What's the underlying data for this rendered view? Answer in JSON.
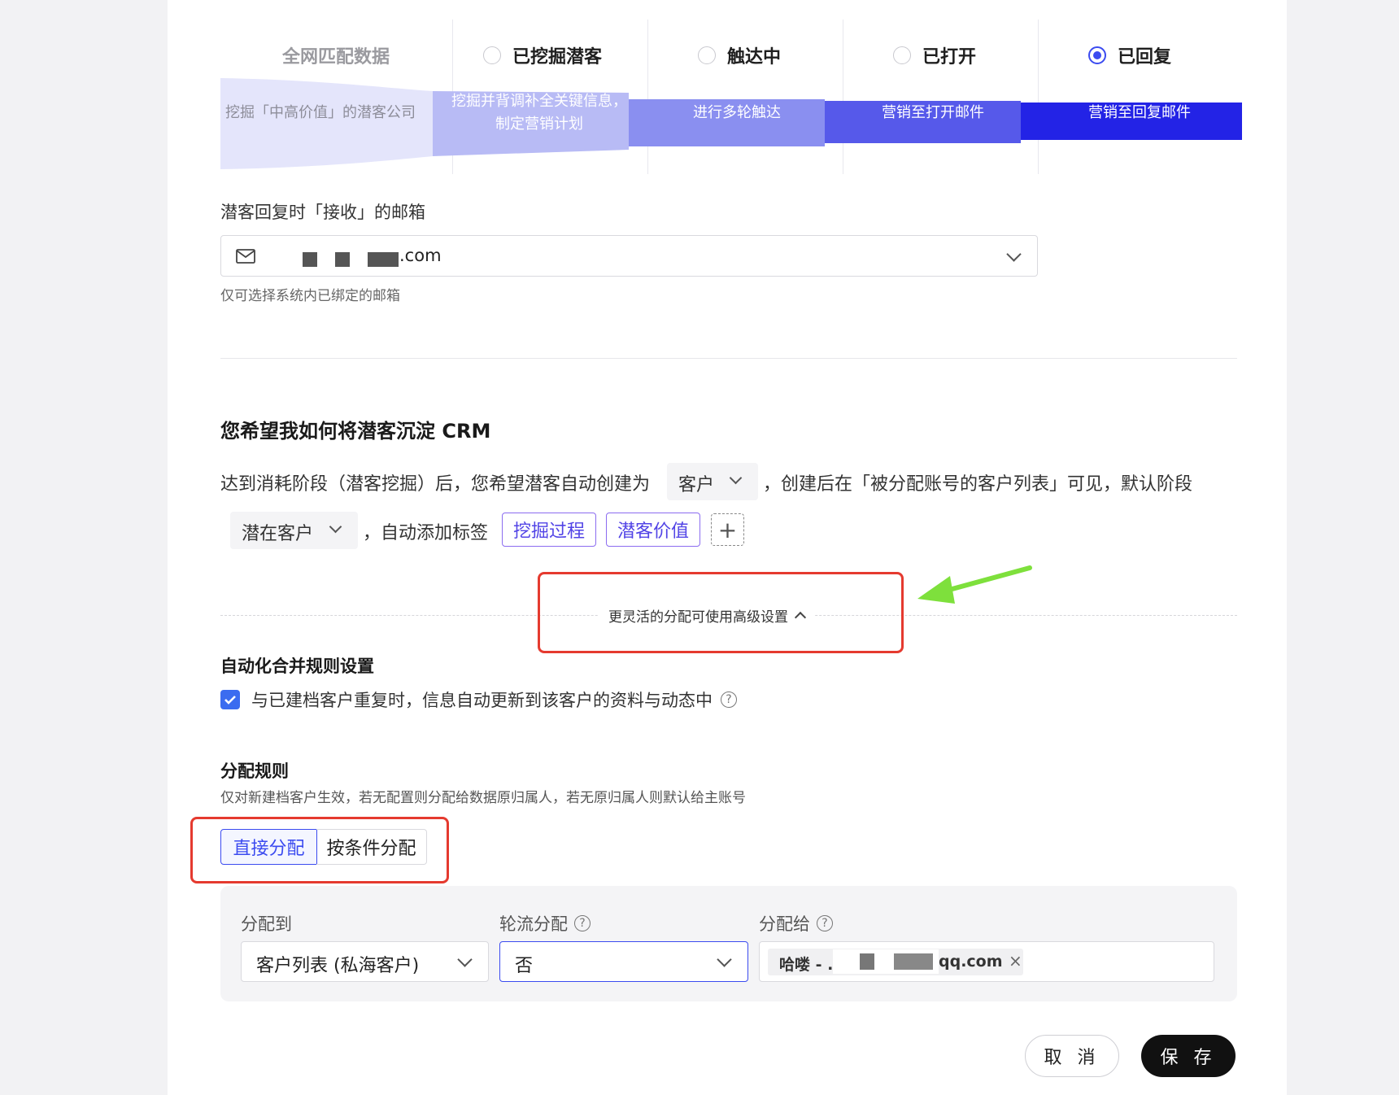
{
  "stages": {
    "first_label": "全网匹配数据",
    "items": [
      {
        "label": "已挖掘潜客",
        "selected": false
      },
      {
        "label": "触达中",
        "selected": false
      },
      {
        "label": "已打开",
        "selected": false
      },
      {
        "label": "已回复",
        "selected": true
      }
    ],
    "funnel": [
      "挖掘「中高价值」的潜客公司",
      "挖掘并背调补全关键信息，",
      "制定营销计划",
      "进行多轮触达",
      "营销至打开邮件",
      "营销至回复邮件"
    ]
  },
  "mailbox": {
    "label": "潜客回复时「接收」的邮箱",
    "value_suffix": ".com",
    "hint": "仅可选择系统内已绑定的邮箱"
  },
  "crm": {
    "title": "您希望我如何将潜客沉淀 CRM",
    "sentence_part1": "达到消耗阶段（潜客挖掘）后，您希望潜客自动创建为",
    "create_as": "客户",
    "sentence_part2": "，创建后在「被分配账号的客户列表」可见，默认阶段",
    "default_stage": "潜在客户",
    "sentence_part3": "，自动添加标签",
    "tags": [
      "挖掘过程",
      "潜客价值"
    ],
    "advanced_link": "更灵活的分配可使用高级设置"
  },
  "merge": {
    "title": "自动化合并规则设置",
    "checkbox_label": "与已建档客户重复时，信息自动更新到该客户的资料与动态中",
    "checked": true
  },
  "assign": {
    "title": "分配规则",
    "hint": "仅对新建档客户生效，若无配置则分配给数据原归属人，若无原归属人则默认给主账号",
    "tabs": [
      "直接分配",
      "按条件分配"
    ],
    "active_tab": 0,
    "to_label": "分配到",
    "to_value": "客户列表 (私海客户)",
    "round_label": "轮流分配",
    "round_value": "否",
    "give_label": "分配给",
    "give_tag_prefix": "哈喽 - .",
    "give_tag_suffix": "qq.com"
  },
  "footer": {
    "cancel": "取 消",
    "save": "保 存"
  },
  "colors": {
    "accent": "#3b4bf0",
    "funnel_deep": "#2323e6",
    "annotation_red": "#e53a2f",
    "annotation_green": "#7ee03c"
  }
}
